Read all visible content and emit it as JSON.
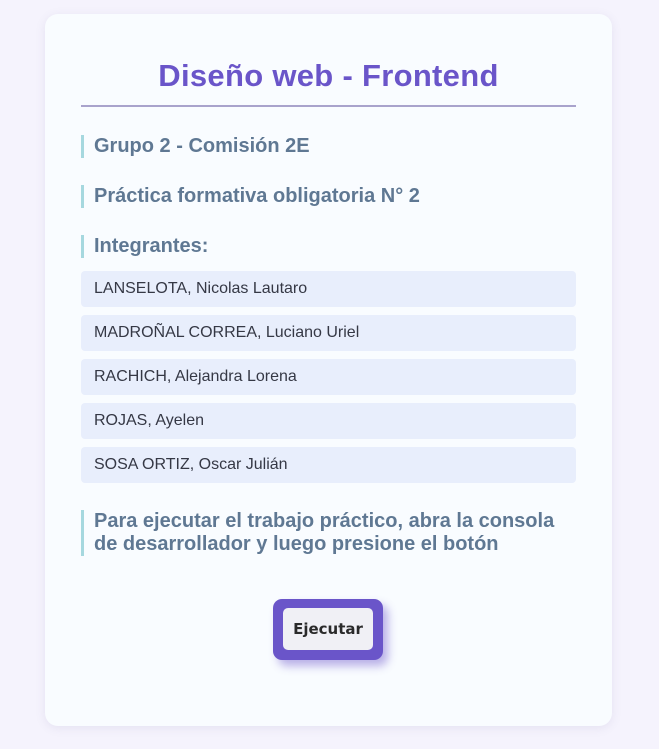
{
  "page": {
    "title": "Diseño web - Frontend",
    "group": "Grupo 2 - Comisión 2E",
    "practice": "Práctica formativa obligatoria N° 2",
    "members_heading": "Integrantes:",
    "members": [
      "LANSELOTA, Nicolas Lautaro",
      "MADROÑAL CORREA, Luciano Uriel",
      "RACHICH, Alejandra Lorena",
      "ROJAS, Ayelen",
      "SOSA ORTIZ, Oscar Julián"
    ],
    "instructions": "Para ejecutar el trabajo práctico, abra la consola de desarrollador y luego presione el botón",
    "run_button": "Ejecutar"
  },
  "colors": {
    "accent": "#6a55c9",
    "heading": "#5f7893",
    "heading_bar": "#a6d8df",
    "member_bg": "#e8eefc",
    "page_bg": "#f5f3fd",
    "card_bg": "#f9fcff"
  }
}
